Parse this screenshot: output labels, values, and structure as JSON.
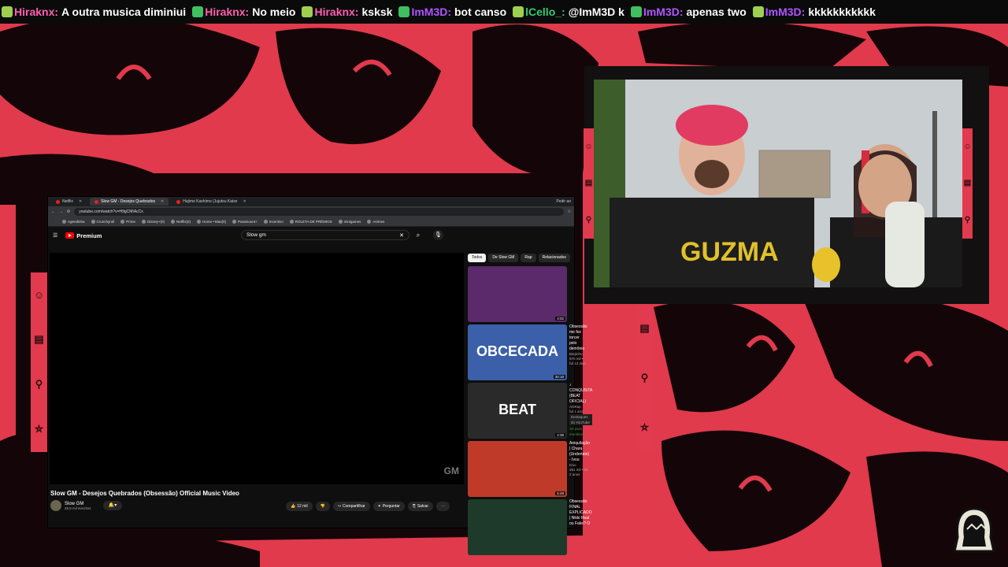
{
  "chat": {
    "messages": [
      {
        "user": "Hiraknx:",
        "text": "A outra musica diminiui",
        "color": "#ff5fb0"
      },
      {
        "user": "Hiraknx:",
        "text": "No meio",
        "color": "#ff5fb0"
      },
      {
        "user": "Hiraknx:",
        "text": "ksksk",
        "color": "#ff5fb0"
      },
      {
        "user": "ImM3D:",
        "text": "bot canso",
        "color": "#b055ff"
      },
      {
        "user": "lCello_:",
        "text": "@ImM3D k",
        "color": "#2ecc71"
      },
      {
        "user": "ImM3D:",
        "text": "apenas two",
        "color": "#b055ff"
      },
      {
        "user": "ImM3D:",
        "text": "kkkkkkkkkkk",
        "color": "#b055ff"
      }
    ]
  },
  "browser": {
    "tabs": [
      {
        "label": "Netflix",
        "active": false
      },
      {
        "label": "Slow GM - Desejos Quebrados",
        "active": true
      },
      {
        "label": "Hajime Kashimo (Jujutsu Kaise",
        "active": false
      }
    ],
    "tab_right_label": "Pedir ao",
    "url": "youtube.com/watch?v=H9gCMIAcCs",
    "bookmarks": [
      "Agendinha",
      "Crunchyroll",
      "Prime",
      "Disney+(0)",
      "Netflix(0)",
      "Home • Max(0)",
      "Paramount+",
      "Incentivo",
      "ROLETA DE PRÊMIOS",
      "minigames",
      "Animes"
    ]
  },
  "youtube": {
    "brand": "Premium",
    "search_value": "Slow gm",
    "video_title": "Slow GM - Desejos Quebrados (Obsessão) Official Music Video",
    "channel_name": "Slow GM",
    "subscribers": "28,5 mil inscritos",
    "watermark": "GM",
    "actions": {
      "likes": "12 mil",
      "share": "Compartilhar",
      "ask": "Perguntar",
      "save": "Salvar"
    },
    "chips": [
      "Todos",
      "De Slow GM",
      "Rap",
      "Relacionados"
    ],
    "recommendations": [
      {
        "title": "",
        "channel": "",
        "stats": "",
        "duration": "4:02",
        "thumb_color": "#5b2a6a"
      },
      {
        "title": "Obsessão me fez torcer pelo demônio",
        "channel": "Barjinho",
        "stats": "670 mil • há 12 dias",
        "duration": "30:18",
        "thumb_color": "#3b5fa8",
        "thumb_text": "OBCECADA"
      },
      {
        "title": "♪ CONQUISTA (BEAT OFICIAL)",
        "channel": "AniRap",
        "stats": "há 1 ano",
        "tag": "Destaques do YouTube",
        "member": "Só para membros",
        "duration": "2:39",
        "thumb_color": "#2a2a2a",
        "thumb_text": "BEAT"
      },
      {
        "title": "Aniquilação | Chara (Undertale) - Ivou",
        "channel": "Ivou",
        "stats": "261 mil • há 2 anos",
        "duration": "5:48",
        "thumb_color": "#c03a2a"
      },
      {
        "title": "Obsessão FINAL EXPLICADO | Nikki Real ou Fake? O",
        "channel": "",
        "stats": "",
        "duration": "",
        "thumb_color": "#1e3a2a"
      }
    ]
  },
  "colors": {
    "accent_red": "#e23a4e",
    "yt_red": "#ff0000"
  }
}
